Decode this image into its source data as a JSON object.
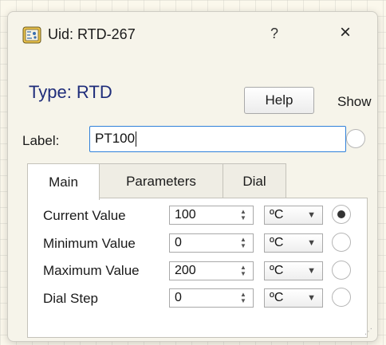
{
  "window": {
    "title": "Uid: RTD-267",
    "help_glyph": "?",
    "close_glyph": "×",
    "icon": "component-icon"
  },
  "header": {
    "type_title": "Type: RTD",
    "help_button": "Help",
    "show_label": "Show"
  },
  "label_field": {
    "label": "Label:",
    "value": "PT100"
  },
  "tabs": [
    {
      "label": "Main",
      "active": true
    },
    {
      "label": "Parameters",
      "active": false
    },
    {
      "label": "Dial",
      "active": false
    }
  ],
  "rows": [
    {
      "label": "Current Value",
      "value": "100",
      "unit": "ºC",
      "show_selected": true
    },
    {
      "label": "Minimum Value",
      "value": "0",
      "unit": "ºC",
      "show_selected": false
    },
    {
      "label": "Maximum Value",
      "value": "200",
      "unit": "ºC",
      "show_selected": false
    },
    {
      "label": "Dial Step",
      "value": "0",
      "unit": "ºC",
      "show_selected": false
    }
  ],
  "colors": {
    "title_blue": "#1f2d7a",
    "focus_border": "#2f80d9",
    "dialog_bg": "#f6f4ea"
  }
}
